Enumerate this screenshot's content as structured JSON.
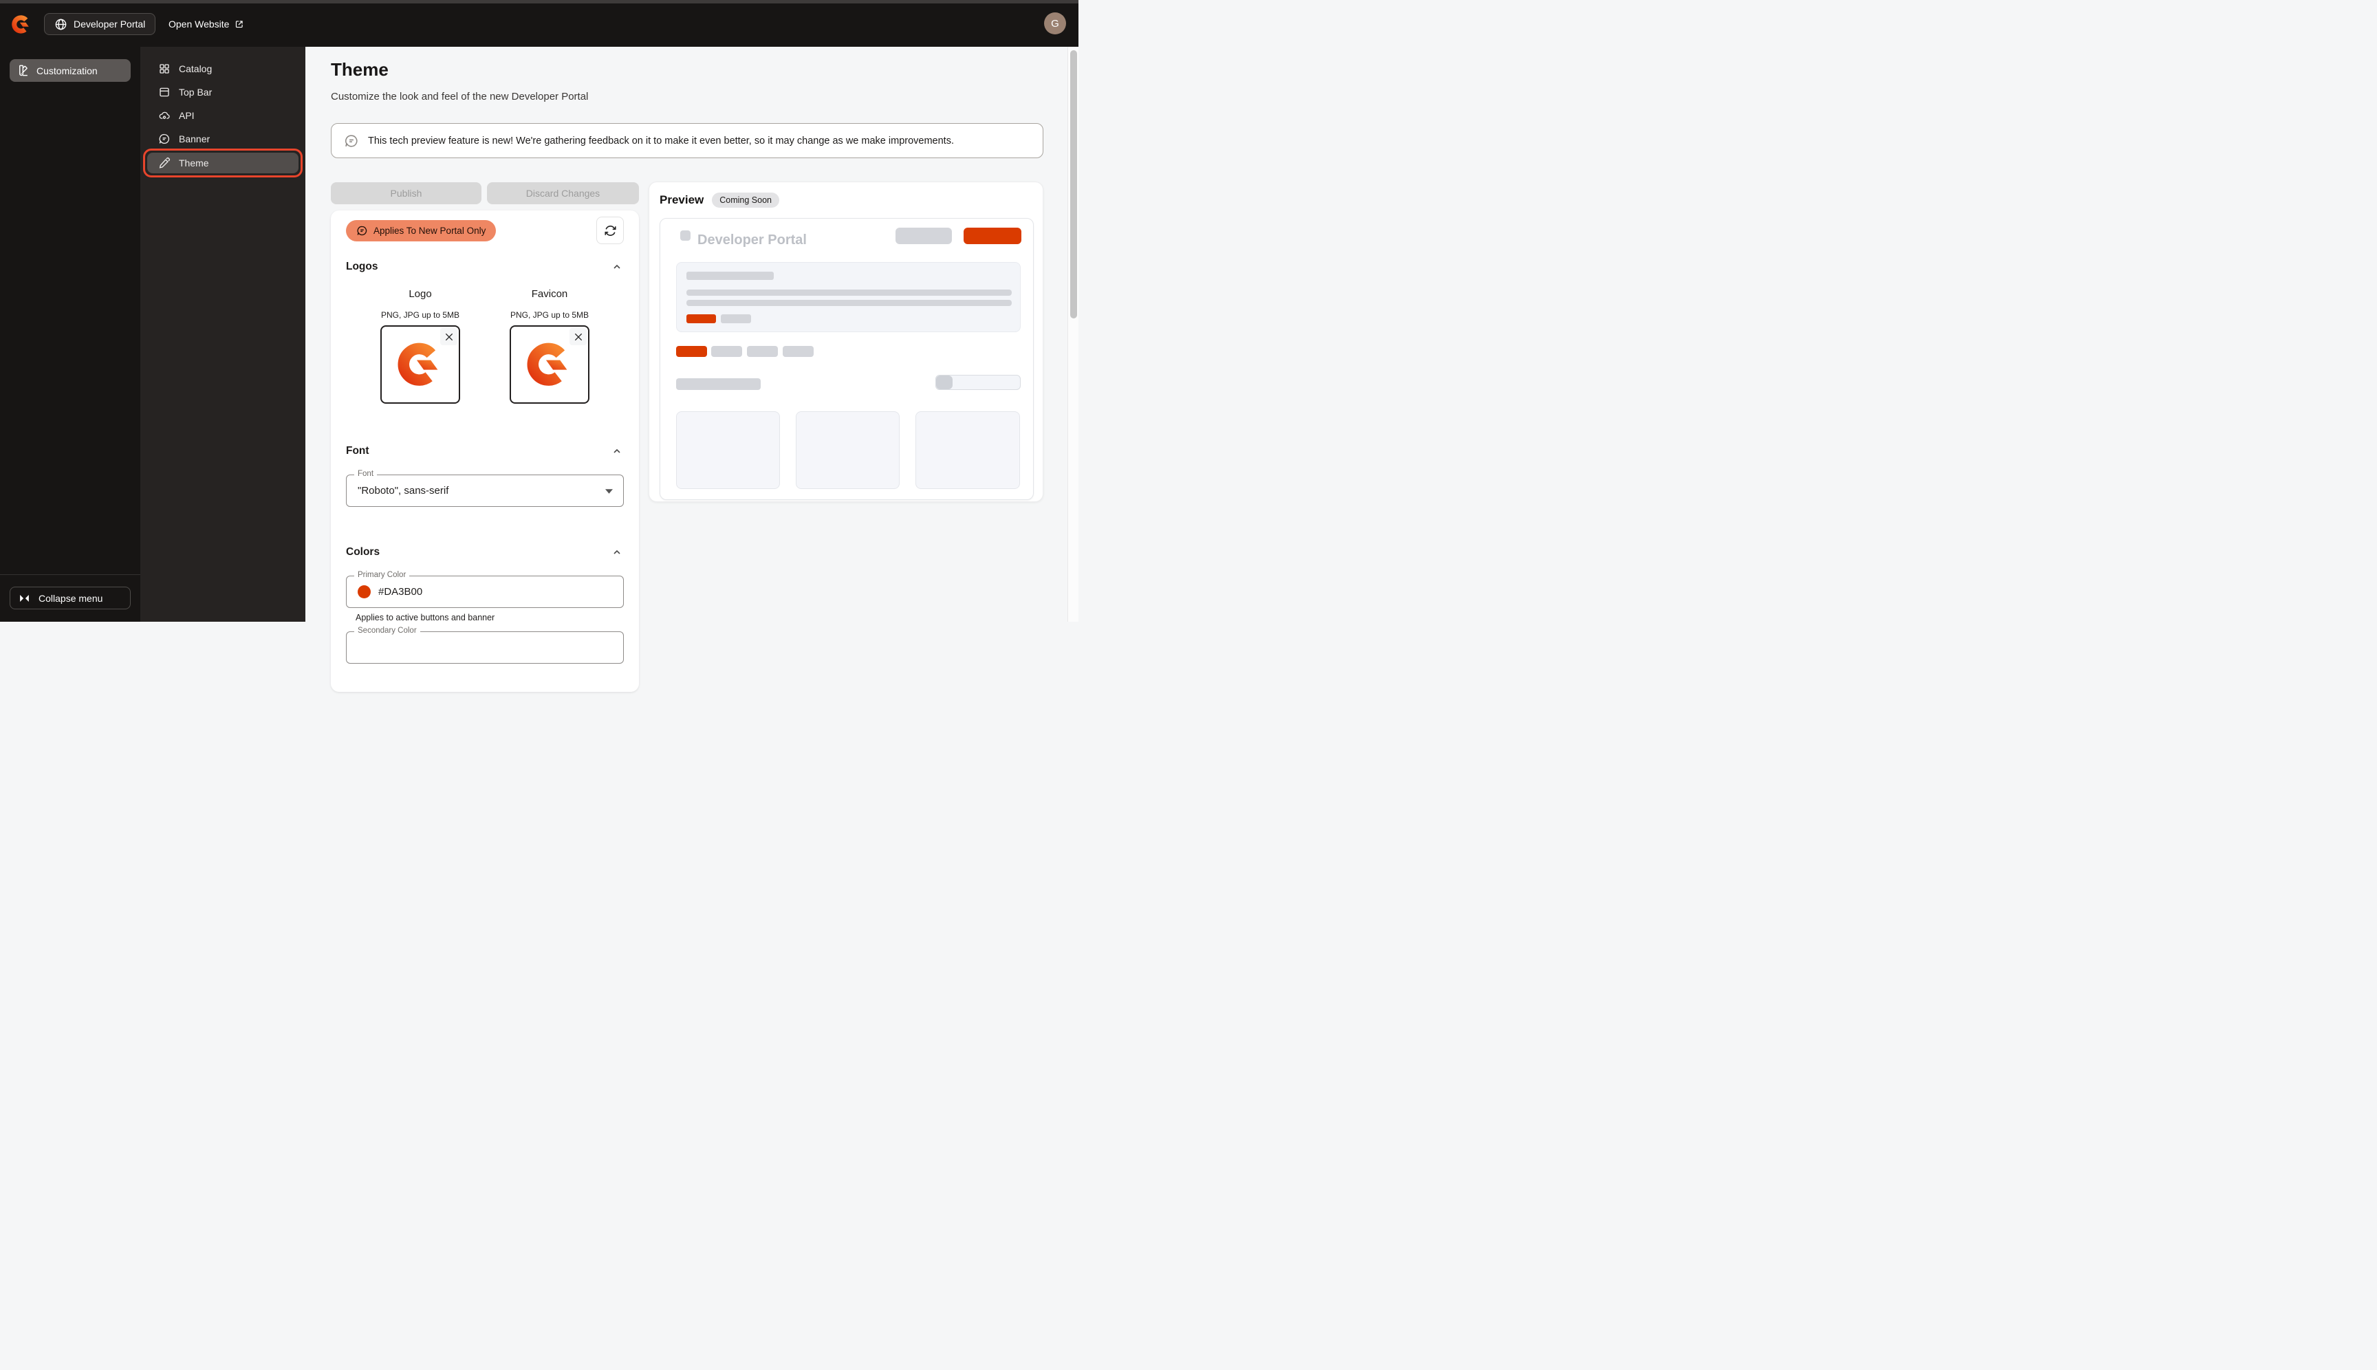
{
  "topbar": {
    "portal_switcher_label": "Developer Portal",
    "open_website_label": "Open Website",
    "avatar_initial": "G"
  },
  "sidebar": {
    "items": [
      {
        "label": "Customization",
        "icon": "swatch-icon",
        "active": true
      }
    ],
    "collapse_label": "Collapse menu"
  },
  "submenu": {
    "items": [
      {
        "label": "Catalog",
        "icon": "catalog-grid-icon",
        "active": false
      },
      {
        "label": "Top Bar",
        "icon": "topbar-window-icon",
        "active": false
      },
      {
        "label": "API",
        "icon": "api-cloud-gear-icon",
        "active": false
      },
      {
        "label": "Banner",
        "icon": "banner-message-icon",
        "active": false
      },
      {
        "label": "Theme",
        "icon": "theme-eyedropper-icon",
        "active": true,
        "highlighted": true
      }
    ]
  },
  "main": {
    "title": "Theme",
    "subtitle": "Customize the look and feel of the new Developer Portal",
    "notice": "This tech preview feature is new! We're gathering feedback on it to make it even better, so it may change as we make improvements.",
    "publish_label": "Publish",
    "discard_label": "Discard Changes",
    "chip_label": "Applies To New Portal Only",
    "sections": {
      "logos": {
        "title": "Logos",
        "uploads": [
          {
            "label": "Logo",
            "hint": "PNG, JPG up to 5MB"
          },
          {
            "label": "Favicon",
            "hint": "PNG, JPG up to 5MB"
          }
        ]
      },
      "font": {
        "title": "Font",
        "field_label": "Font",
        "value": "\"Roboto\", sans-serif"
      },
      "colors": {
        "title": "Colors",
        "primary_label": "Primary Color",
        "primary_value": "#DA3B00",
        "primary_hint": "Applies to active buttons and banner",
        "secondary_label": "Secondary Color"
      }
    }
  },
  "preview": {
    "title": "Preview",
    "badge": "Coming Soon",
    "mock_title": "Developer Portal"
  },
  "colors": {
    "primary": "#DA3B00",
    "chip_bg": "#EF8763",
    "highlight_outline": "#E8452C"
  }
}
